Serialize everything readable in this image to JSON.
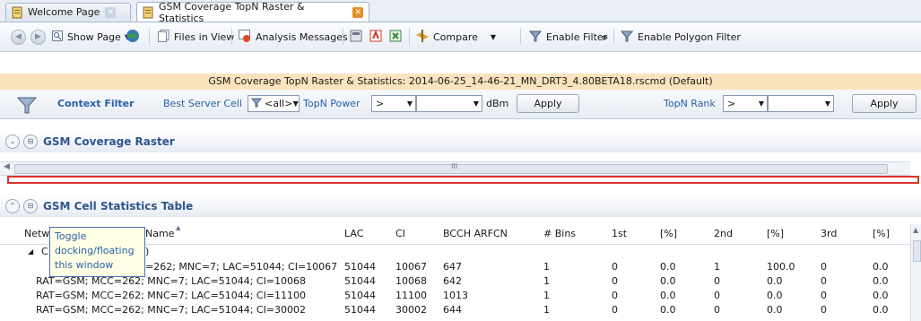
{
  "tabs": [
    {
      "label": "Welcome Page",
      "active": false
    },
    {
      "label": "GSM Coverage TopN Raster & Statistics",
      "active": true
    }
  ],
  "toolbar": {
    "show_page": "Show Page",
    "files_in_view": "Files in View",
    "analysis_messages": "Analysis Messages",
    "compare": "Compare",
    "enable_filter": "Enable Filter",
    "overflow": "»",
    "enable_polygon_filter": "Enable Polygon Filter"
  },
  "banner": {
    "text": "GSM Coverage TopN Raster & Statistics:  2014-06-25_14-46-21_MN_DRT3_4.80BETA18.rscmd (Default)"
  },
  "context_filter": {
    "title": "Context Filter",
    "best_server_label": "Best Server Cell",
    "best_server_value": "<all>",
    "topn_power_label": "TopN Power",
    "power_operator": ">",
    "power_value": "",
    "power_unit": "dBm",
    "apply_label": "Apply",
    "topn_rank_label": "TopN Rank",
    "rank_operator": ">",
    "rank_value": "",
    "apply2_label": "Apply"
  },
  "raster_panel": {
    "title": "GSM Coverage Raster",
    "scroll_marker": "III"
  },
  "stats_panel": {
    "title": "GSM Cell Statistics Table"
  },
  "table": {
    "columns": [
      "Netw",
      "Name",
      "LAC",
      "CI",
      "BCCH ARFCN",
      "# Bins",
      "1st",
      "[%]",
      "2nd",
      "[%]",
      "3rd",
      "[%]"
    ],
    "group_row": {
      "expander": "◢",
      "text": "C",
      "suffix": ")"
    },
    "rows": [
      {
        "name": "RAT=GSM; MCC=262; MNC=7; LAC=51044; CI=10067",
        "lac": "51044",
        "ci": "10067",
        "bcch": "647",
        "bins": "1",
        "first": "0",
        "p1": "0.0",
        "second": "1",
        "p2": "100.0",
        "third": "0",
        "p3": "0.0"
      },
      {
        "name": "RAT=GSM; MCC=262; MNC=7; LAC=51044; CI=10068",
        "lac": "51044",
        "ci": "10068",
        "bcch": "642",
        "bins": "1",
        "first": "0",
        "p1": "0.0",
        "second": "0",
        "p2": "0.0",
        "third": "0",
        "p3": "0.0"
      },
      {
        "name": "RAT=GSM; MCC=262; MNC=7; LAC=51044; CI=11100",
        "lac": "51044",
        "ci": "11100",
        "bcch": "1013",
        "bins": "1",
        "first": "0",
        "p1": "0.0",
        "second": "0",
        "p2": "0.0",
        "third": "0",
        "p3": "0.0"
      },
      {
        "name": "RAT=GSM; MCC=262; MNC=7; LAC=51044; CI=30002",
        "lac": "51044",
        "ci": "30002",
        "bcch": "644",
        "bins": "1",
        "first": "0",
        "p1": "0.0",
        "second": "0",
        "p2": "0.0",
        "third": "0",
        "p3": "0.0"
      }
    ],
    "first_row_name_visible": "=262; MNC=7; LAC=51044; CI=10067"
  },
  "tooltip": {
    "line1": "Toggle",
    "line2": "docking/floating",
    "line3": "this window"
  },
  "colors": {
    "accent": "#2e5490",
    "banner": "#fbe3bd",
    "splitter": "#d9342b",
    "tooltip_border": "#4a6fb5"
  }
}
